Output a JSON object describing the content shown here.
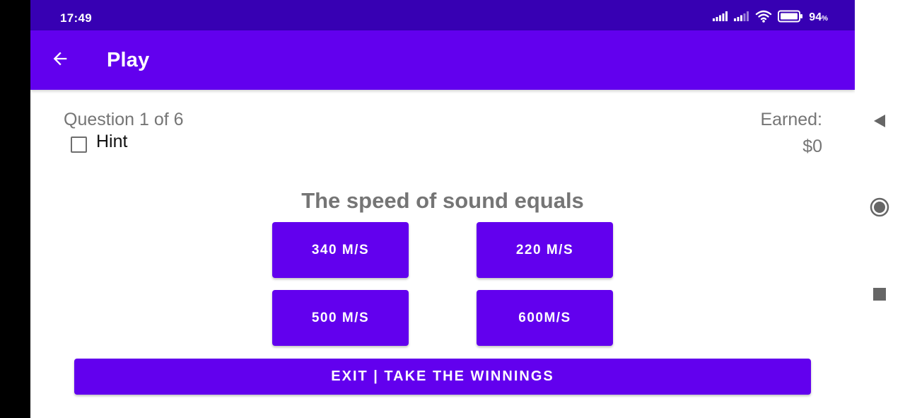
{
  "status_bar": {
    "time": "17:49",
    "battery_percent": "94",
    "battery_unit": "%",
    "icons": [
      "signal-icon",
      "signal-icon",
      "wifi-icon",
      "battery-icon"
    ]
  },
  "app_bar": {
    "title": "Play",
    "back_icon": "arrow-left-icon"
  },
  "game": {
    "question_counter": "Question 1 of 6",
    "hint_label": "Hint",
    "hint_checked": false,
    "earned_label": "Earned:",
    "earned_value": "$0",
    "question": "The speed of sound equals",
    "answers": [
      "340 M/S",
      "220 M/S",
      "500 M/S",
      "600M/S"
    ],
    "exit_label": "EXIT | TAKE THE WINNINGS"
  },
  "nav_bar": {
    "buttons": [
      "back-triangle-icon",
      "home-circle-icon",
      "recents-square-icon"
    ]
  },
  "colors": {
    "status_bar": "#3700B3",
    "primary": "#6200EE",
    "secondary_text": "#757575"
  }
}
